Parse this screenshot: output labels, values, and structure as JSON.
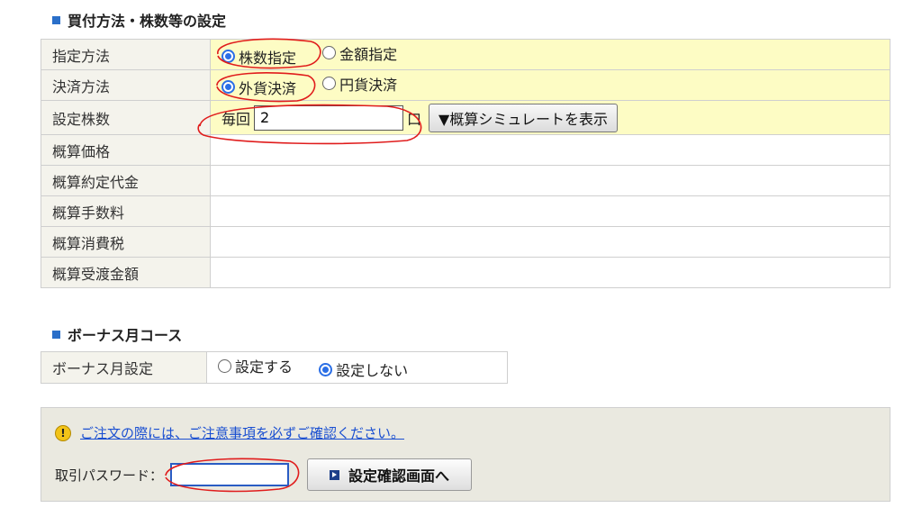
{
  "section1": {
    "title": "買付方法・株数等の設定"
  },
  "buy_table": {
    "method": {
      "label": "指定方法",
      "options": [
        "株数指定",
        "金額指定"
      ],
      "selected": 0
    },
    "settlement": {
      "label": "決済方法",
      "options": [
        "外貨決済",
        "円貨決済"
      ],
      "selected": 0
    },
    "quantity": {
      "label": "設定株数",
      "prefix": "毎回",
      "value": "2",
      "unit": "口",
      "sim_button": "▼概算シミュレートを表示"
    },
    "estimates": [
      {
        "label": "概算価格",
        "value": ""
      },
      {
        "label": "概算約定代金",
        "value": ""
      },
      {
        "label": "概算手数料",
        "value": ""
      },
      {
        "label": "概算消費税",
        "value": ""
      },
      {
        "label": "概算受渡金額",
        "value": ""
      }
    ]
  },
  "section2": {
    "title": "ボーナス月コース"
  },
  "bonus_table": {
    "label": "ボーナス月設定",
    "options": [
      "設定する",
      "設定しない"
    ],
    "selected": 1
  },
  "notice": {
    "link_text": "ご注文の際には、ご注意事項を必ずご確認ください。",
    "password_label": "取引パスワード：",
    "password_value": "",
    "confirm_button": "設定確認画面へ"
  },
  "colors": {
    "highlight_row": "#fdfcc4",
    "label_cell": "#f4f3ec",
    "accent": "#2a6fc9",
    "annotation": "#e01c1c"
  }
}
